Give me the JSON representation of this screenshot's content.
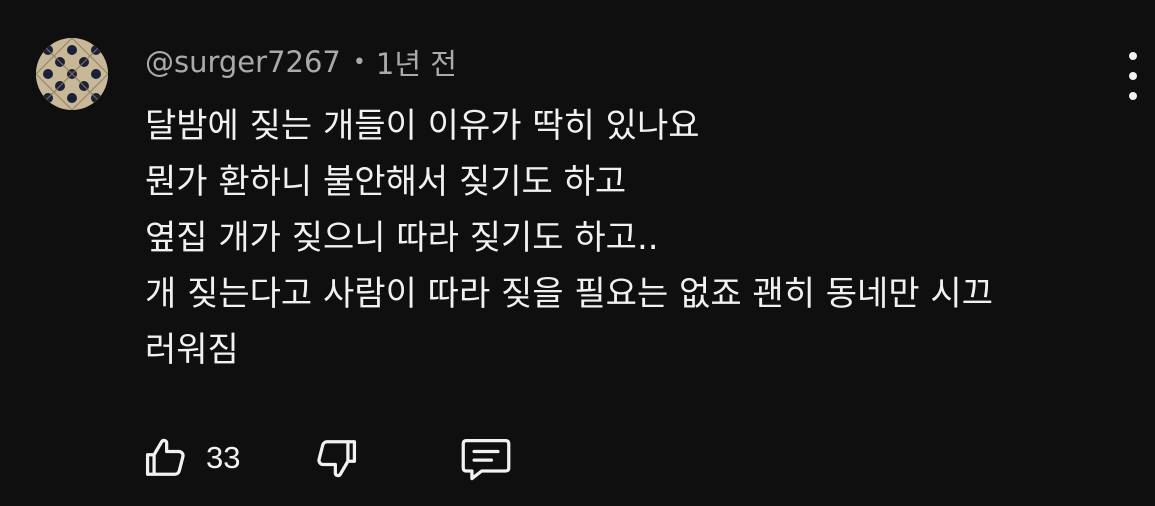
{
  "comment": {
    "author": "@surger7267",
    "separator": "•",
    "time_ago": "1년 전",
    "lines": [
      "달밤에 짖는 개들이 이유가 딱히 있나요",
      "뭔가 환하니 불안해서 짖기도 하고",
      "옆집 개가 짖으니 따라 짖기도 하고..",
      "개 짖는다고 사람이 따라 짖을 필요는 없죠 괜히 동네만 시끄",
      "러워짐"
    ],
    "like_count": "33"
  },
  "icons": {
    "avatar": "avatar-pattern",
    "more": "more-vert-icon",
    "like": "thumb-up-icon",
    "dislike": "thumb-down-icon",
    "reply": "comment-icon"
  },
  "colors": {
    "background": "#0f0f0f",
    "text_primary": "#f1f1f1",
    "text_secondary": "#aaaaaa"
  }
}
